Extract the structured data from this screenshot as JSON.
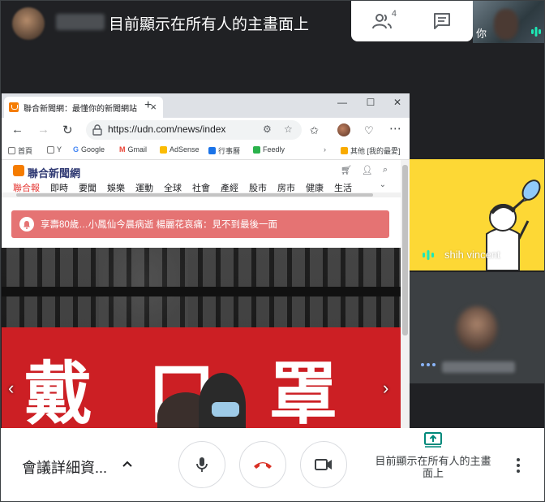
{
  "presenter": {
    "title": "目前顯示在所有人的主畫面上"
  },
  "top_panel": {
    "people_count": "4"
  },
  "self_tile": {
    "label": "你"
  },
  "browser": {
    "tab_title": "聯合新聞網：最懂你的新聞網站",
    "url": "https://udn.com/news/index",
    "bookmarks": [
      "首頁",
      "Y",
      "Google",
      "Gmail",
      "AdSense",
      "行事曆",
      "Feedly",
      "其他 [我的最愛]"
    ],
    "site": {
      "logo": "聯合新聞網",
      "nav": [
        "聯合報",
        "即時",
        "要聞",
        "娛樂",
        "運動",
        "全球",
        "社會",
        "產經",
        "股市",
        "房市",
        "健康",
        "生活"
      ]
    },
    "alert": "享壽80歲…小鳳仙今晨病逝 楊麗花哀痛：見不到最後一面",
    "banner_chars": [
      "戴",
      "口",
      "罩"
    ]
  },
  "participants": [
    {
      "name": "shih vincent"
    }
  ],
  "controls": {
    "meeting_details": "會議詳細資...",
    "presenting_label": "目前顯示在所有人的主畫面上"
  },
  "colors": {
    "accent_green": "#00897b",
    "hangup_red": "#d93025",
    "alert_bg": "#e57373",
    "tile_yellow": "#fdd835"
  }
}
